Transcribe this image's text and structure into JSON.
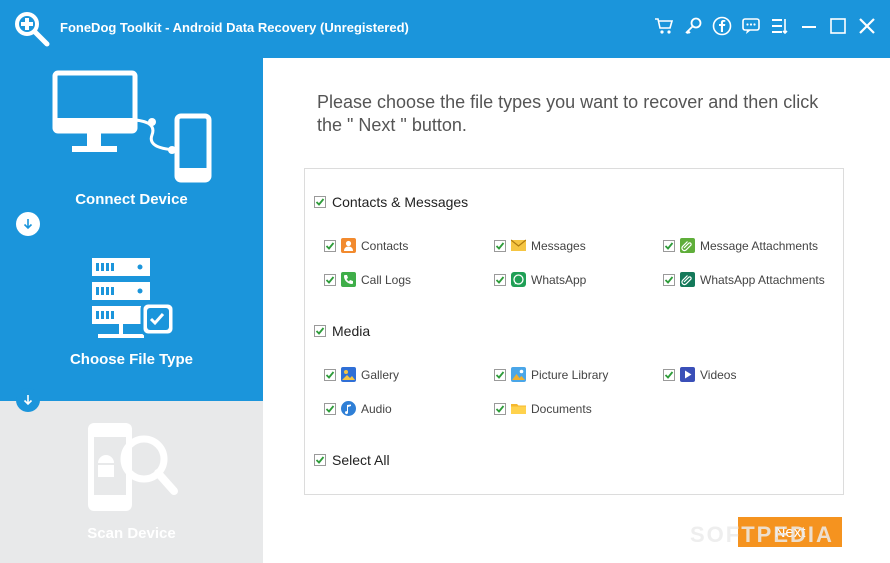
{
  "window": {
    "title": "FoneDog Toolkit - Android Data Recovery (Unregistered)",
    "toolbar_icons": [
      "cart-icon",
      "key-icon",
      "facebook-icon",
      "chat-icon",
      "menu-icon",
      "minimize-icon",
      "maximize-icon",
      "close-icon"
    ]
  },
  "sidebar": {
    "steps": [
      {
        "label": "Connect Device"
      },
      {
        "label": "Choose File Type"
      },
      {
        "label": "Scan Device"
      }
    ]
  },
  "main": {
    "instructions": "Please choose the file types you want to recover and then click the \" Next \" button.",
    "groups": [
      {
        "label": "Contacts & Messages",
        "checked": true,
        "items": [
          {
            "label": "Contacts",
            "icon": "contacts-icon",
            "checked": true
          },
          {
            "label": "Messages",
            "icon": "messages-icon",
            "checked": true
          },
          {
            "label": "Message Attachments",
            "icon": "attachment-icon",
            "checked": true
          },
          {
            "label": "Call Logs",
            "icon": "phone-icon",
            "checked": true
          },
          {
            "label": "WhatsApp",
            "icon": "whatsapp-icon",
            "checked": true
          },
          {
            "label": "WhatsApp Attachments",
            "icon": "whatsapp-attachment-icon",
            "checked": true
          }
        ]
      },
      {
        "label": "Media",
        "checked": true,
        "items": [
          {
            "label": "Gallery",
            "icon": "gallery-icon",
            "checked": true
          },
          {
            "label": "Picture Library",
            "icon": "picture-library-icon",
            "checked": true
          },
          {
            "label": "Videos",
            "icon": "video-icon",
            "checked": true
          },
          {
            "label": "Audio",
            "icon": "audio-icon",
            "checked": true
          },
          {
            "label": "Documents",
            "icon": "folder-icon",
            "checked": true
          }
        ]
      }
    ],
    "select_all": {
      "label": "Select All",
      "checked": true
    },
    "next_label": "Next"
  },
  "watermark": "SOFTPEDIA",
  "colors": {
    "accent": "#1b95db",
    "next": "#f5931f",
    "check": "#2e9c3a",
    "disabled_step": "#e8e9ea"
  }
}
